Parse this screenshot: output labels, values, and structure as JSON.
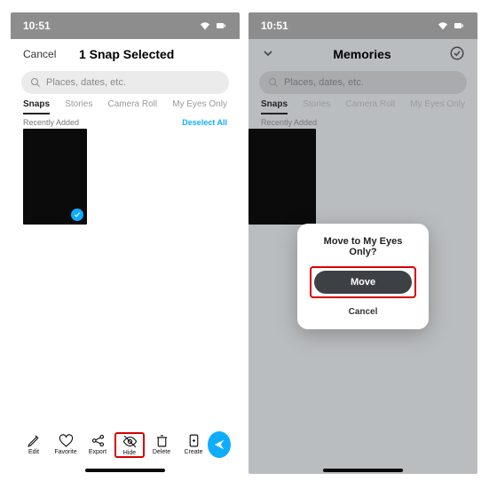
{
  "status": {
    "time": "10:51"
  },
  "left": {
    "nav": {
      "cancel": "Cancel",
      "title": "1 Snap Selected"
    },
    "search": {
      "placeholder": "Places, dates, etc."
    },
    "tabs": {
      "snaps": "Snaps",
      "stories": "Stories",
      "camera_roll": "Camera Roll",
      "my_eyes": "My Eyes Only"
    },
    "subrow": {
      "recently": "Recently Added",
      "deselect": "Deselect All"
    },
    "toolbar": {
      "edit": "Edit",
      "favorite": "Favorite",
      "export": "Export",
      "hide": "Hide",
      "delete": "Delete",
      "create": "Create"
    }
  },
  "right": {
    "nav": {
      "title": "Memories"
    },
    "search": {
      "placeholder": "Places, dates, etc."
    },
    "tabs": {
      "snaps": "Snaps",
      "stories": "Stories",
      "camera_roll": "Camera Roll",
      "my_eyes": "My Eyes Only"
    },
    "subrow": {
      "recently": "Recently Added"
    },
    "dialog": {
      "title": "Move to My Eyes Only?",
      "move": "Move",
      "cancel": "Cancel"
    }
  }
}
